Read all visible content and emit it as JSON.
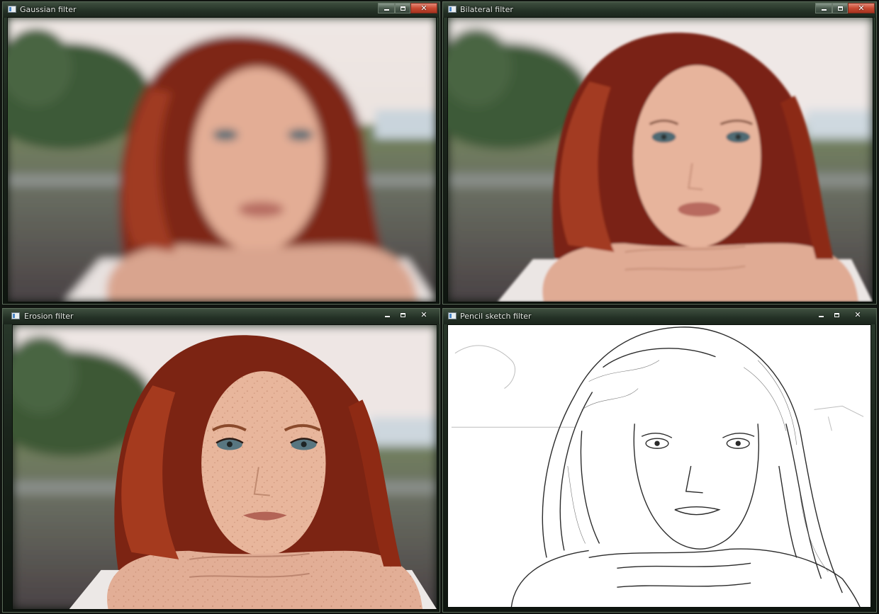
{
  "windows": {
    "gaussian": {
      "title": "Gaussian filter"
    },
    "bilateral": {
      "title": "Bilateral filter"
    },
    "erosion": {
      "title": "Erosion filter"
    },
    "pencil": {
      "title": "Pencil sketch filter"
    }
  },
  "controls": {
    "minimize_icon": "minimize-icon",
    "maximize_icon": "maximize-icon",
    "close_icon": "close-icon",
    "close_glyph": "✕"
  },
  "colors": {
    "close_active": "#c84a32",
    "hair": "#8a2c1a",
    "sky": "#eee6e4",
    "grass": "#6e8a5a"
  }
}
